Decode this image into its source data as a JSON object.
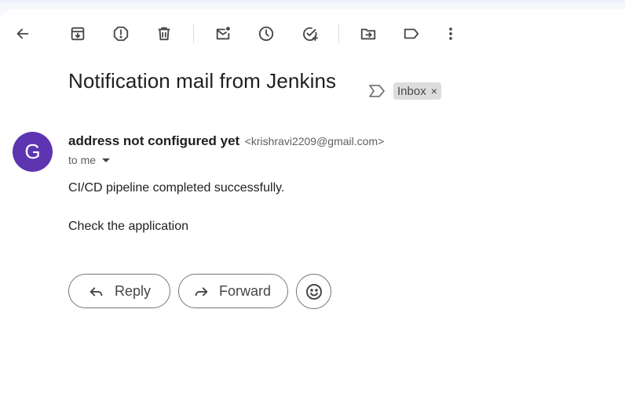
{
  "toolbar": {
    "icons": [
      "back-arrow-icon",
      "archive-icon",
      "report-spam-icon",
      "delete-icon",
      "mark-unread-icon",
      "snooze-icon",
      "add-to-tasks-icon",
      "move-to-icon",
      "labels-icon",
      "more-options-icon"
    ]
  },
  "email": {
    "subject": "Notification mail from Jenkins",
    "label_chip": "Inbox",
    "label_remove": "×",
    "avatar_letter": "G",
    "avatar_color": "#5e35b1",
    "sender_name": "address not configured yet",
    "sender_email": "<krishravi2209@gmail.com>",
    "recipient": "to me",
    "body": [
      "CI/CD pipeline completed successfully.",
      "Check the application"
    ]
  },
  "actions": {
    "reply": "Reply",
    "forward": "Forward"
  }
}
